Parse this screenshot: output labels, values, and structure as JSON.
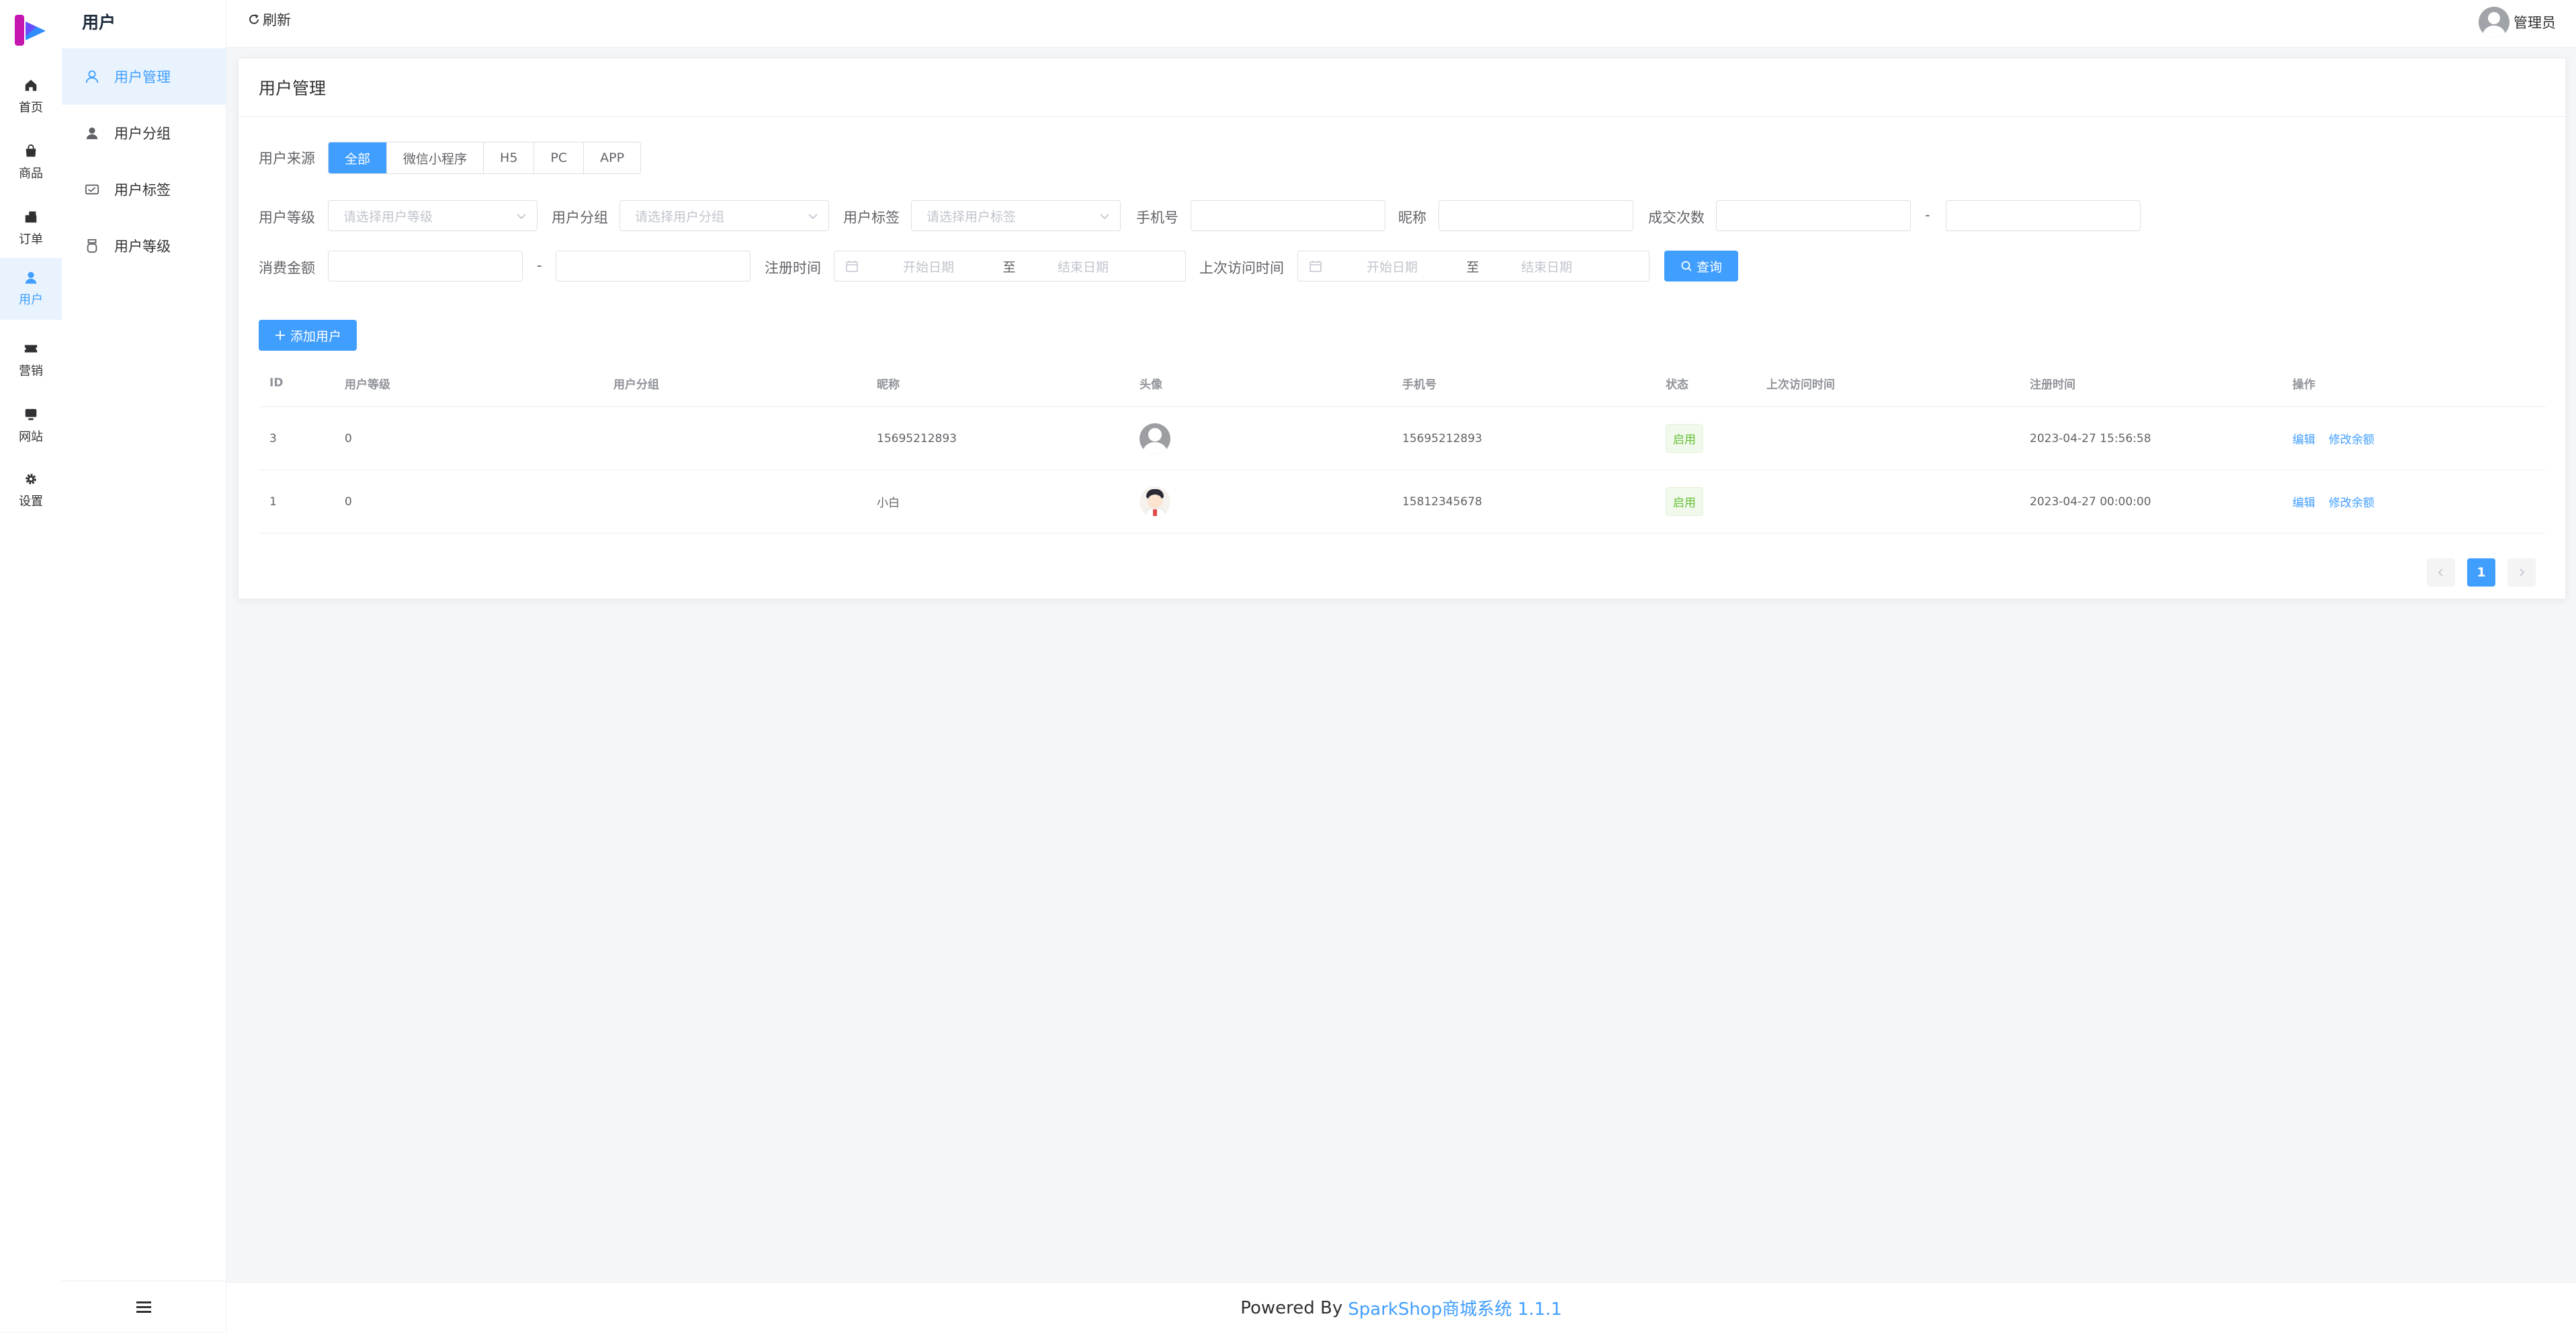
{
  "rail": {
    "items": [
      {
        "label": "首页",
        "icon": "home-icon"
      },
      {
        "label": "商品",
        "icon": "goods-bag-icon"
      },
      {
        "label": "订单",
        "icon": "order-icon"
      },
      {
        "label": "用户",
        "icon": "user-icon"
      },
      {
        "label": "营销",
        "icon": "ticket-icon"
      },
      {
        "label": "网站",
        "icon": "monitor-icon"
      },
      {
        "label": "设置",
        "icon": "gear-icon"
      }
    ],
    "active_index": 3
  },
  "submenu": {
    "title": "用户",
    "items": [
      {
        "label": "用户管理",
        "icon": "user-outline-icon"
      },
      {
        "label": "用户分组",
        "icon": "user-filled-icon"
      },
      {
        "label": "用户标签",
        "icon": "tag-card-icon"
      },
      {
        "label": "用户等级",
        "icon": "medal-icon"
      }
    ],
    "active_index": 0
  },
  "header": {
    "refresh_label": "刷新",
    "user_name": "管理员"
  },
  "card": {
    "title": "用户管理"
  },
  "filters": {
    "source_label": "用户来源",
    "source_options": [
      "全部",
      "微信小程序",
      "H5",
      "PC",
      "APP"
    ],
    "source_selected": "全部",
    "level_label": "用户等级",
    "level_placeholder": "请选择用户等级",
    "group_label": "用户分组",
    "group_placeholder": "请选择用户分组",
    "tag_label": "用户标签",
    "tag_placeholder": "请选择用户标签",
    "phone_label": "手机号",
    "nickname_label": "昵称",
    "deals_label": "成交次数",
    "amount_label": "消费金额",
    "range_sep": "-",
    "reg_time_label": "注册时间",
    "visit_time_label": "上次访问时间",
    "start_placeholder": "开始日期",
    "end_placeholder": "结束日期",
    "date_sep": "至",
    "search_label": "查询"
  },
  "add_user_label": "添加用户",
  "table": {
    "columns": [
      "ID",
      "用户等级",
      "用户分组",
      "昵称",
      "头像",
      "手机号",
      "状态",
      "上次访问时间",
      "注册时间",
      "操作"
    ],
    "rows": [
      {
        "id": "3",
        "level": "0",
        "group": "",
        "nickname": "15695212893",
        "avatar": "default-avatar",
        "phone": "15695212893",
        "status": "启用",
        "last_visit": "",
        "reg_time": "2023-04-27 15:56:58",
        "edit": "编辑",
        "balance": "修改余额"
      },
      {
        "id": "1",
        "level": "0",
        "group": "",
        "nickname": "小白",
        "avatar": "cartoon-avatar",
        "phone": "15812345678",
        "status": "启用",
        "last_visit": "",
        "reg_time": "2023-04-27 00:00:00",
        "edit": "编辑",
        "balance": "修改余额"
      }
    ]
  },
  "pagination": {
    "current": "1",
    "prev_icon": "chevron-left-icon",
    "next_icon": "chevron-right-icon"
  },
  "footer": {
    "prefix": "Powered By",
    "brand": "SparkShop商城系统 1.1.1"
  },
  "colors": {
    "primary": "#409eff",
    "success": "#67c23a",
    "active_bg": "#e9f3fe"
  }
}
